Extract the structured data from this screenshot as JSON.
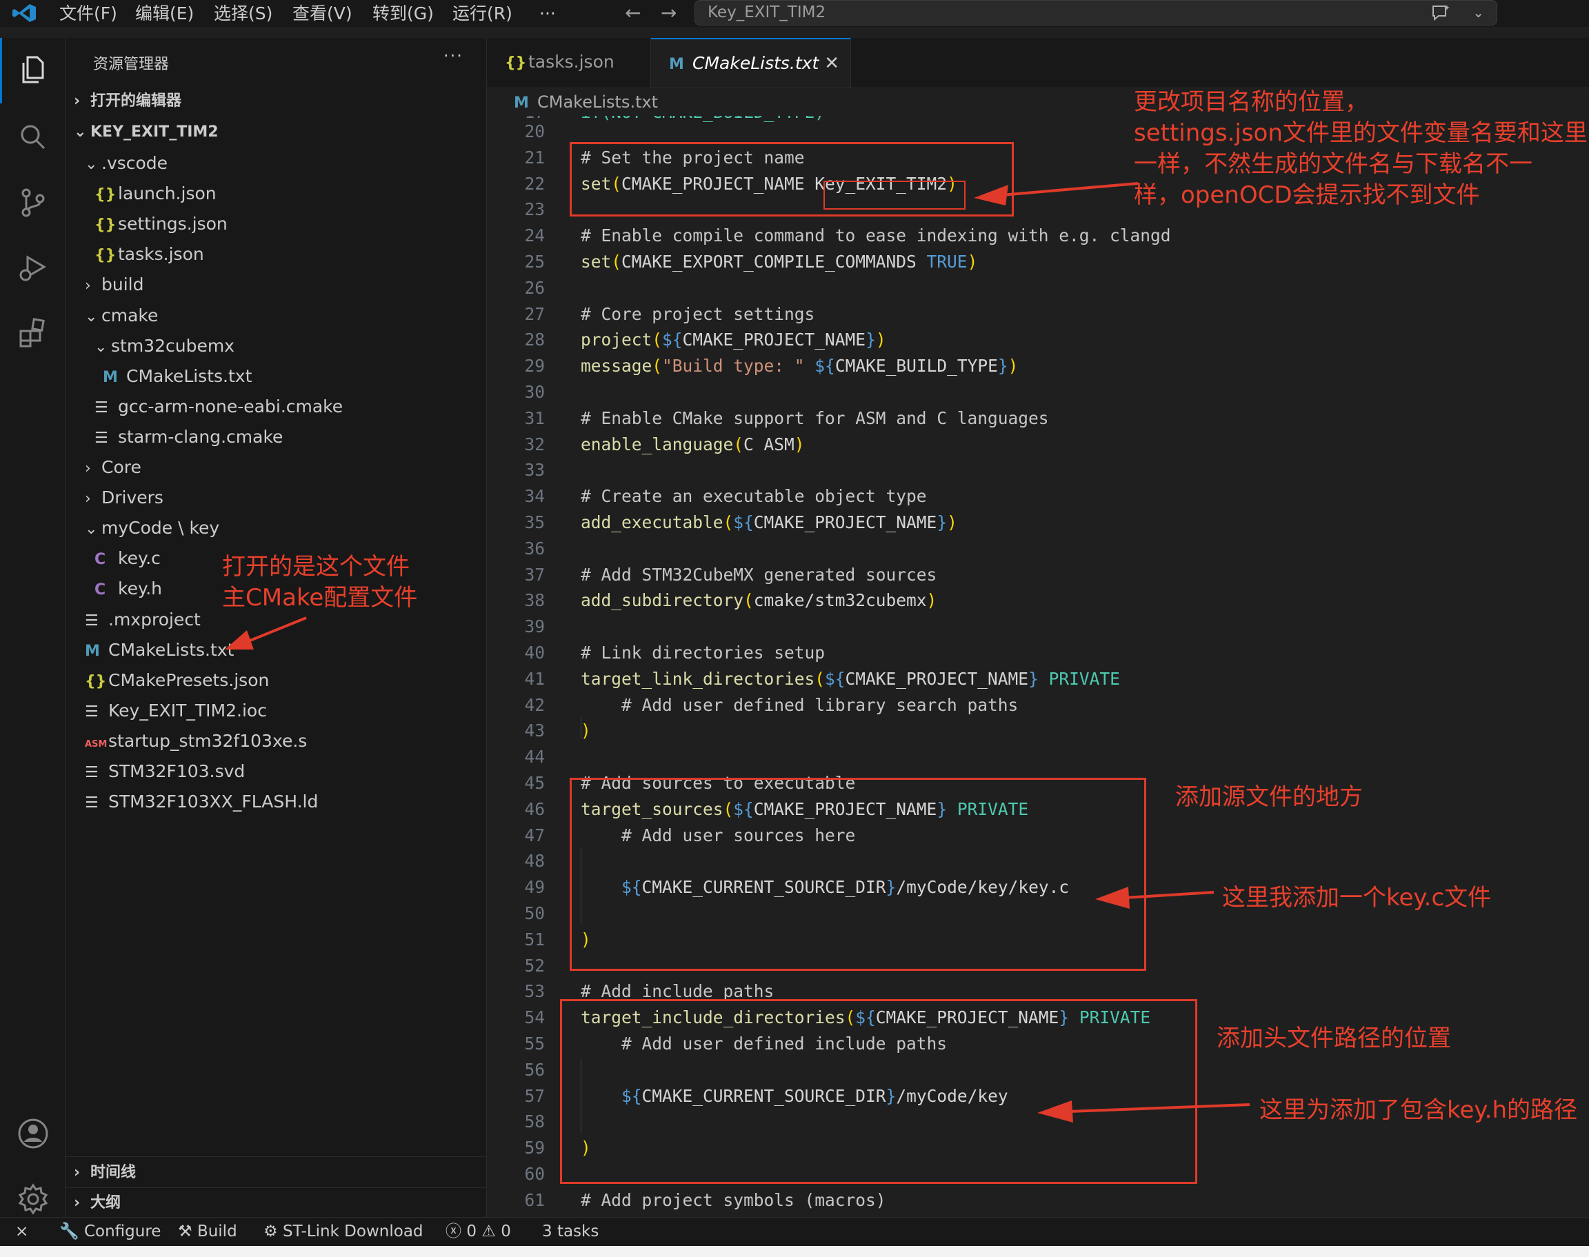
{
  "titlebar": {
    "menus": [
      "文件(F)",
      "编辑(E)",
      "选择(S)",
      "查看(V)",
      "转到(G)",
      "运行(R)",
      "···"
    ],
    "search_text": "Key_EXIT_TIM2"
  },
  "sidebar": {
    "header": "资源管理器",
    "more": "···",
    "sections": {
      "open_editors": "打开的编辑器",
      "project": "KEY_EXIT_TIM2",
      "timeline": "时间线",
      "outline": "大纲"
    },
    "tree": [
      {
        "label": ".vscode",
        "kind": "folder-open",
        "depth": 1
      },
      {
        "label": "launch.json",
        "kind": "json",
        "depth": 2,
        "icon": "{}"
      },
      {
        "label": "settings.json",
        "kind": "json",
        "depth": 2,
        "icon": "{}"
      },
      {
        "label": "tasks.json",
        "kind": "json",
        "depth": 2,
        "icon": "{}"
      },
      {
        "label": "build",
        "kind": "folder",
        "depth": 1
      },
      {
        "label": "cmake",
        "kind": "folder-open",
        "depth": 1
      },
      {
        "label": "stm32cubemx",
        "kind": "folder-open",
        "depth": 2
      },
      {
        "label": "CMakeLists.txt",
        "kind": "m",
        "depth": 3,
        "icon": "M"
      },
      {
        "label": "gcc-arm-none-eabi.cmake",
        "kind": "lines",
        "depth": 2,
        "icon": "☰"
      },
      {
        "label": "starm-clang.cmake",
        "kind": "lines",
        "depth": 2,
        "icon": "☰"
      },
      {
        "label": "Core",
        "kind": "folder",
        "depth": 1
      },
      {
        "label": "Drivers",
        "kind": "folder",
        "depth": 1
      },
      {
        "label": "myCode \\ key",
        "kind": "folder-open",
        "depth": 1
      },
      {
        "label": "key.c",
        "kind": "c",
        "depth": 2,
        "icon": "C"
      },
      {
        "label": "key.h",
        "kind": "c",
        "depth": 2,
        "icon": "C"
      },
      {
        "label": ".mxproject",
        "kind": "lines",
        "depth": 1,
        "icon": "☰"
      },
      {
        "label": "CMakeLists.txt",
        "kind": "m",
        "depth": 1,
        "icon": "M"
      },
      {
        "label": "CMakePresets.json",
        "kind": "json",
        "depth": 1,
        "icon": "{}"
      },
      {
        "label": "Key_EXIT_TIM2.ioc",
        "kind": "lines",
        "depth": 1,
        "icon": "☰"
      },
      {
        "label": "startup_stm32f103xe.s",
        "kind": "asm",
        "depth": 1,
        "icon": "ASM"
      },
      {
        "label": "STM32F103.svd",
        "kind": "lines",
        "depth": 1,
        "icon": "☰"
      },
      {
        "label": "STM32F103XX_FLASH.ld",
        "kind": "lines",
        "depth": 1,
        "icon": "☰"
      }
    ]
  },
  "tabs": [
    {
      "label": "tasks.json",
      "icon": "{}",
      "active": false
    },
    {
      "label": "CMakeLists.txt",
      "icon": "M",
      "active": true,
      "close": "✕"
    }
  ],
  "breadcrumb": {
    "icon": "M",
    "label": "CMakeLists.txt"
  },
  "editor": {
    "lines": [
      {
        "n": "17",
        "t": [
          [
            "kw",
            "if(NOT CMAKE_BUILD_TYPE)"
          ]
        ]
      },
      {
        "n": "20",
        "t": []
      },
      {
        "n": "21",
        "t": [
          [
            "cm",
            "# Set the project name"
          ]
        ]
      },
      {
        "n": "22",
        "t": [
          [
            "fn",
            "set"
          ],
          [
            "br",
            "("
          ],
          [
            "vr",
            "CMAKE_PROJECT_NAME "
          ],
          [
            "plain",
            "Key_EXIT_TIM2"
          ],
          [
            "br",
            ")"
          ]
        ]
      },
      {
        "n": "23",
        "t": []
      },
      {
        "n": "24",
        "t": [
          [
            "cm",
            "# Enable compile command to ease indexing with e.g. clangd"
          ]
        ]
      },
      {
        "n": "25",
        "t": [
          [
            "fn",
            "set"
          ],
          [
            "br",
            "("
          ],
          [
            "vr",
            "CMAKE_EXPORT_COMPILE_COMMANDS "
          ],
          [
            "tr",
            "TRUE"
          ],
          [
            "br",
            ")"
          ]
        ]
      },
      {
        "n": "26",
        "t": []
      },
      {
        "n": "27",
        "t": [
          [
            "cm",
            "# Core project settings"
          ]
        ]
      },
      {
        "n": "28",
        "t": [
          [
            "fn",
            "project"
          ],
          [
            "br",
            "("
          ],
          [
            "dl",
            "${"
          ],
          [
            "vr",
            "CMAKE_PROJECT_NAME"
          ],
          [
            "dl",
            "}"
          ],
          [
            "br",
            ")"
          ]
        ]
      },
      {
        "n": "29",
        "t": [
          [
            "fn",
            "message"
          ],
          [
            "br",
            "("
          ],
          [
            "st",
            "\"Build type: \" "
          ],
          [
            "dl",
            "${"
          ],
          [
            "vr",
            "CMAKE_BUILD_TYPE"
          ],
          [
            "dl",
            "}"
          ],
          [
            "br",
            ")"
          ]
        ]
      },
      {
        "n": "30",
        "t": []
      },
      {
        "n": "31",
        "t": [
          [
            "cm",
            "# Enable CMake support for ASM and C languages"
          ]
        ]
      },
      {
        "n": "32",
        "t": [
          [
            "fn",
            "enable_language"
          ],
          [
            "br",
            "("
          ],
          [
            "vr",
            "C ASM"
          ],
          [
            "br",
            ")"
          ]
        ]
      },
      {
        "n": "33",
        "t": []
      },
      {
        "n": "34",
        "t": [
          [
            "cm",
            "# Create an executable object type"
          ]
        ]
      },
      {
        "n": "35",
        "t": [
          [
            "fn",
            "add_executable"
          ],
          [
            "br",
            "("
          ],
          [
            "dl",
            "${"
          ],
          [
            "vr",
            "CMAKE_PROJECT_NAME"
          ],
          [
            "dl",
            "}"
          ],
          [
            "br",
            ")"
          ]
        ]
      },
      {
        "n": "36",
        "t": []
      },
      {
        "n": "37",
        "t": [
          [
            "cm",
            "# Add STM32CubeMX generated sources"
          ]
        ]
      },
      {
        "n": "38",
        "t": [
          [
            "fn",
            "add_subdirectory"
          ],
          [
            "br",
            "("
          ],
          [
            "vr",
            "cmake/stm32cubemx"
          ],
          [
            "br",
            ")"
          ]
        ]
      },
      {
        "n": "39",
        "t": []
      },
      {
        "n": "40",
        "t": [
          [
            "cm",
            "# Link directories setup"
          ]
        ]
      },
      {
        "n": "41",
        "t": [
          [
            "fn",
            "target_link_directories"
          ],
          [
            "br",
            "("
          ],
          [
            "dl",
            "${"
          ],
          [
            "vr",
            "CMAKE_PROJECT_NAME"
          ],
          [
            "dl",
            "}"
          ],
          [
            "kw",
            " PRIVATE"
          ]
        ]
      },
      {
        "n": "42",
        "t": [
          [
            "cm",
            "    # Add user defined library search paths"
          ]
        ]
      },
      {
        "n": "43",
        "t": [
          [
            "br",
            ")"
          ]
        ]
      },
      {
        "n": "44",
        "t": []
      },
      {
        "n": "45",
        "t": [
          [
            "cm",
            "# Add sources to executable"
          ]
        ]
      },
      {
        "n": "46",
        "t": [
          [
            "fn",
            "target_sources"
          ],
          [
            "br",
            "("
          ],
          [
            "dl",
            "${"
          ],
          [
            "vr",
            "CMAKE_PROJECT_NAME"
          ],
          [
            "dl",
            "}"
          ],
          [
            "kw",
            " PRIVATE"
          ]
        ]
      },
      {
        "n": "47",
        "t": [
          [
            "cm",
            "    # Add user sources here"
          ]
        ]
      },
      {
        "n": "48",
        "t": []
      },
      {
        "n": "49",
        "t": [
          [
            "plain",
            "    "
          ],
          [
            "dl",
            "${"
          ],
          [
            "vr",
            "CMAKE_CURRENT_SOURCE_DIR"
          ],
          [
            "dl",
            "}"
          ],
          [
            "vr",
            "/myCode/key/key.c"
          ]
        ]
      },
      {
        "n": "50",
        "t": []
      },
      {
        "n": "51",
        "t": [
          [
            "br",
            ")"
          ]
        ]
      },
      {
        "n": "52",
        "t": []
      },
      {
        "n": "53",
        "t": [
          [
            "cm",
            "# Add include paths"
          ]
        ]
      },
      {
        "n": "54",
        "t": [
          [
            "fn",
            "target_include_directories"
          ],
          [
            "br",
            "("
          ],
          [
            "dl",
            "${"
          ],
          [
            "vr",
            "CMAKE_PROJECT_NAME"
          ],
          [
            "dl",
            "}"
          ],
          [
            "kw",
            " PRIVATE"
          ]
        ]
      },
      {
        "n": "55",
        "t": [
          [
            "cm",
            "    # Add user defined include paths"
          ]
        ]
      },
      {
        "n": "56",
        "t": []
      },
      {
        "n": "57",
        "t": [
          [
            "plain",
            "    "
          ],
          [
            "dl",
            "${"
          ],
          [
            "vr",
            "CMAKE_CURRENT_SOURCE_DIR"
          ],
          [
            "dl",
            "}"
          ],
          [
            "vr",
            "/myCode/key"
          ]
        ]
      },
      {
        "n": "58",
        "t": []
      },
      {
        "n": "59",
        "t": [
          [
            "br",
            ")"
          ]
        ]
      },
      {
        "n": "60",
        "t": []
      },
      {
        "n": "61",
        "t": [
          [
            "cm",
            "# Add project symbols (macros)"
          ]
        ]
      }
    ]
  },
  "annotations": {
    "project_name": [
      "更改项目名称的位置，",
      "settings.json文件里的文件变量名要和这里",
      "一样，不然生成的文件名与下载名不一",
      "样，openOCD会提示找不到文件"
    ],
    "opened_file": [
      "打开的是这个文件",
      "主CMake配置文件"
    ],
    "sources": "添加源文件的地方",
    "key_c": "这里我添加一个key.c文件",
    "include": "添加头文件路径的位置",
    "key_h": "这里为添加了包含key.h的路径"
  },
  "statusbar": {
    "configure": "Configure",
    "build": "Build",
    "stlink": "ST-Link Download",
    "errors": "0",
    "warnings": "0",
    "tasks": "3 tasks"
  },
  "colors": {
    "accent": "#0078d4",
    "annotation_red": "#e03a2a"
  }
}
